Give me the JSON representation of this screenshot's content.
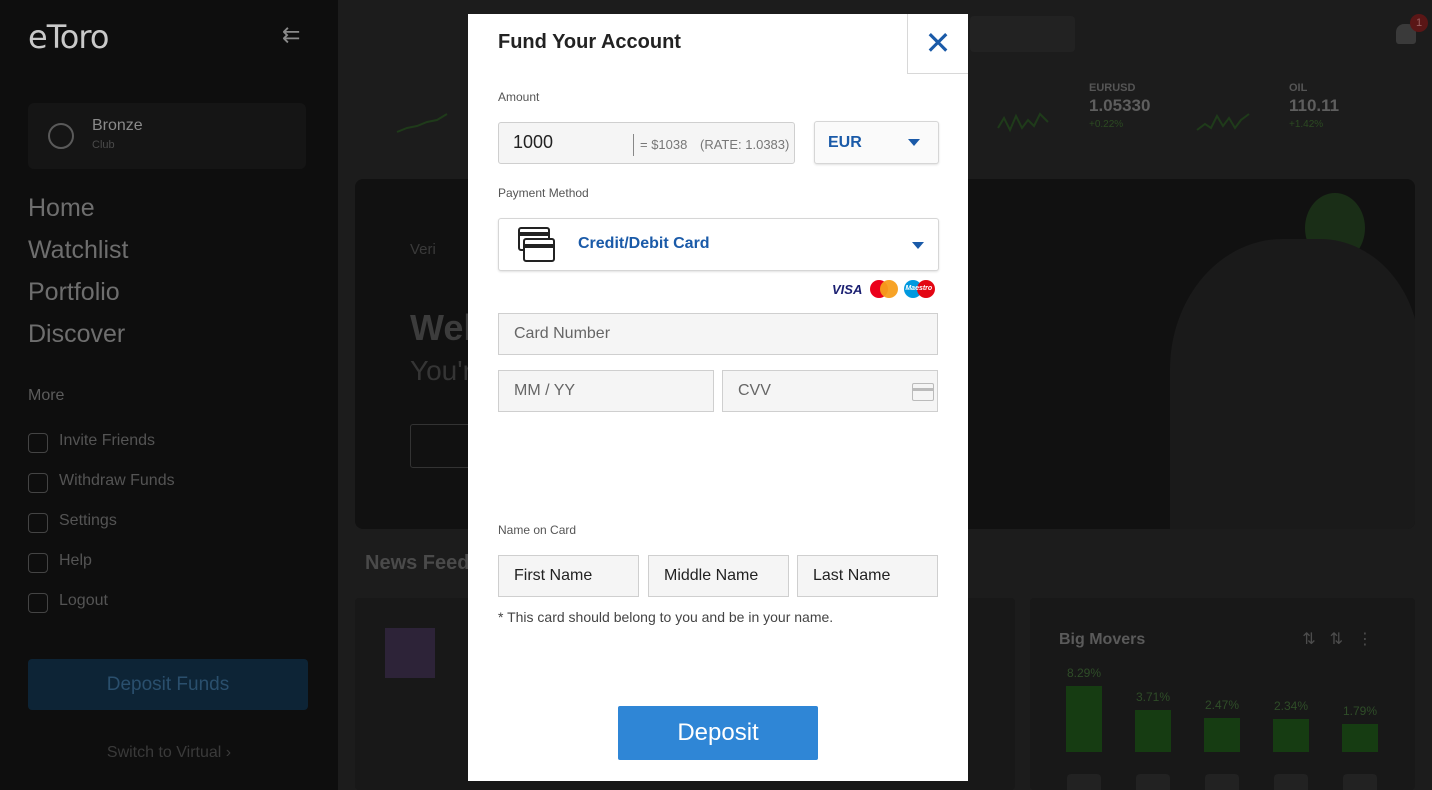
{
  "sidebar": {
    "logo": "eToro",
    "club": {
      "name": "Bronze",
      "sub": "Club"
    },
    "main_nav": [
      "Home",
      "Watchlist",
      "Portfolio",
      "Discover"
    ],
    "more_title": "More",
    "more_nav": [
      {
        "label": "Invite Friends",
        "icon": "megaphone-icon"
      },
      {
        "label": "Withdraw Funds",
        "icon": "coins-icon"
      },
      {
        "label": "Settings",
        "icon": "gear-icon"
      },
      {
        "label": "Help",
        "icon": "help-icon"
      },
      {
        "label": "Logout",
        "icon": "logout-icon"
      }
    ],
    "deposit_label": "Deposit Funds",
    "switch_label": "Switch to Virtual ›"
  },
  "header": {
    "notifications_count": "1"
  },
  "tickers": [
    {
      "symbol": "EURUSD",
      "price": "1.05330",
      "change": "+0.22%"
    },
    {
      "symbol": "OIL",
      "price": "110.11",
      "change": "+1.42%"
    }
  ],
  "hero": {
    "verify": "Veri",
    "line1": "Wel",
    "line2": "You'r"
  },
  "news": {
    "title": "News Feed"
  },
  "movers": {
    "title": "Big Movers",
    "values": [
      8.29,
      3.71,
      2.47,
      2.34,
      1.79
    ],
    "labels": [
      "8.29%",
      "3.71%",
      "2.47%",
      "2.34%",
      "1.79%"
    ]
  },
  "modal": {
    "title": "Fund Your Account",
    "close_icon": "close-icon",
    "amount_label": "Amount",
    "amount_value": "1000",
    "amount_converted": "= $1038",
    "amount_rate": "(RATE: 1.0383)",
    "currency": "EUR",
    "payment_label": "Payment Method",
    "payment_value": "Credit/Debit Card",
    "brands": {
      "visa": "VISA",
      "maestro": "Maestro"
    },
    "card_number_placeholder": "Card Number",
    "expiry_placeholder": "MM / YY",
    "cvv_placeholder": "CVV",
    "name_label": "Name on Card",
    "first_name": "First Name",
    "middle_name": "Middle Name",
    "last_name": "Last Name",
    "note": "* This card should belong to you and be in your name.",
    "deposit_label": "Deposit"
  },
  "colors": {
    "accent": "#1a5aa8",
    "deposit_button": "#2f86d6",
    "positive": "#2c4a22"
  }
}
